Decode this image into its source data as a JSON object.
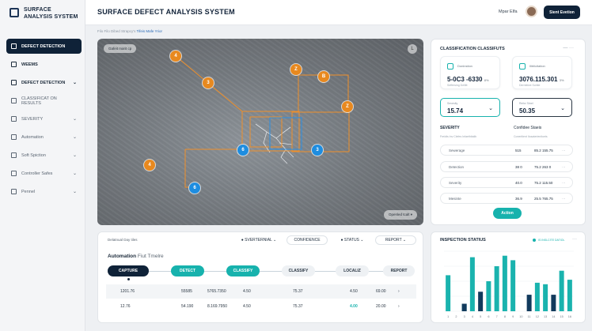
{
  "sidebar": {
    "brand_line1": "SURFACE",
    "brand_line2": "ANALYSIS SYSTEM",
    "items": [
      {
        "label": "DEFECT DETECTION",
        "chevron": ""
      },
      {
        "label": "WEEMS",
        "chevron": ""
      },
      {
        "label": "DEFECT DETECTION",
        "chevron": "⌄"
      },
      {
        "label": "CLASSIFICAT ON RESULTS",
        "chevron": ""
      },
      {
        "label": "SEVERITY",
        "chevron": "⌄"
      },
      {
        "label": "Automation",
        "chevron": "⌄"
      },
      {
        "label": "Soft Spiction",
        "chevron": "⌄"
      },
      {
        "label": "Controller Safes",
        "chevron": "⌄"
      },
      {
        "label": "Pennel",
        "chevron": "⌄"
      }
    ]
  },
  "header": {
    "title": "SURFACE DEFECT ANALYSIS SYSTEM",
    "user_name": "Mpar Elfa",
    "button_label": "Sient Evetion"
  },
  "breadcrumb": {
    "path": "Filo Filo Dibed Strapcy's",
    "current": "Tifeis Mafe Yrior"
  },
  "viewer": {
    "top_chip": "Gafeit marit cp",
    "zoom_icon": "L",
    "bottom_chip": "Openled tcalt ▾",
    "markers": [
      "4",
      "3",
      "Z",
      "B",
      "Z",
      "4",
      "6",
      "6",
      "3"
    ]
  },
  "automation": {
    "left_label": "Delatnual Day tiles",
    "filters": [
      "● SVERTERNIAL ⌄",
      "CONFIDENCE",
      "● STATUS ⌄",
      "REPORT ⌄"
    ],
    "title": "Automation",
    "title_suffix": "Fiut Tmelre",
    "stages": [
      "CAPTURE",
      "DETECT",
      "CLASSIFY",
      "CLASSIFY",
      "LOCALIZ",
      "REPORT"
    ],
    "rows": [
      [
        "1201.76",
        "55585",
        "5765.7350",
        "4.50",
        "75.37",
        "4.50",
        "69.00",
        "›"
      ],
      [
        "12.76",
        "54.190",
        "8.169.7950",
        "4.50",
        "75.37",
        "4.00",
        "20.00",
        "›"
      ]
    ]
  },
  "results": {
    "title": "CLASSIFICATION CLASSIFUTS",
    "menu": "— ···",
    "cards": [
      {
        "label": "Doninstion",
        "value": "5-0C3 -6330",
        "unit": "8%",
        "sub": "Seffersing Delltit"
      },
      {
        "label": "Ilitrlicitation",
        "value": "3076.115.301",
        "unit": "3%",
        "sub": "Dermitiive Sohite"
      }
    ],
    "selects": [
      {
        "label": "Sevesity",
        "value": "15.74",
        "chevron": "⌄"
      },
      {
        "label": "Refor Sbrel",
        "value": "50.35",
        "chevron": "⌄"
      }
    ],
    "severity_head": "SEVERITY",
    "severity_note": "Freidts Inv Clefes Infaethitalib",
    "confidence_head": "Confidee Staeis",
    "confidence_note": "Coneritient Itosaterienitoets",
    "severity_rows": [
      {
        "name": "Sewerage",
        "a": "515",
        "b": "85.2 155.75"
      },
      {
        "name": "Detection",
        "a": "38 0",
        "b": "75.2 263 0"
      },
      {
        "name": "Severity",
        "a": "40.0",
        "b": "75.2 115.50"
      },
      {
        "name": "Mesinte",
        "a": "36.9",
        "b": "25.5 765.75"
      }
    ],
    "row_menu": "···",
    "action_label": "Action"
  },
  "status": {
    "title": "INSPECTION STATIUS",
    "legend": "IS INSLCITE DATIOL",
    "menu": "···"
  },
  "chart_data": {
    "type": "bar",
    "title": "INSPECTION STATIUS",
    "categories": [
      "1",
      "2",
      "3",
      "4",
      "5",
      "6",
      "7",
      "8",
      "9",
      "10",
      "11",
      "12",
      "13",
      "14",
      "15",
      "16"
    ],
    "series": [
      {
        "values": [
          48,
          0,
          10,
          72,
          0,
          40,
          60,
          74,
          68,
          0,
          0,
          38,
          36,
          0,
          54,
          42
        ]
      },
      {
        "values": [
          0,
          0,
          10,
          0,
          26,
          0,
          0,
          0,
          0,
          0,
          22,
          0,
          0,
          22,
          0,
          0
        ]
      }
    ],
    "colors": [
      "#1ab3ae",
      "#123a5c"
    ],
    "ylim": [
      0,
      80
    ],
    "grid": true
  }
}
